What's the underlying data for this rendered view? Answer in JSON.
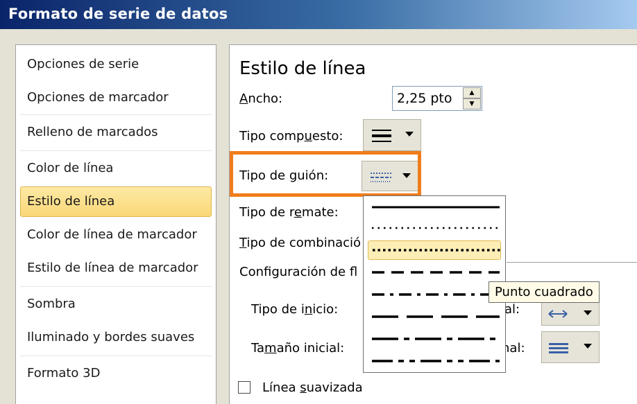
{
  "window": {
    "title": "Formato de serie de datos"
  },
  "sidebar": {
    "items": [
      {
        "label": "Opciones de serie",
        "selected": false
      },
      {
        "label": "Opciones de marcador",
        "selected": false
      },
      {
        "label": "Relleno de marcados",
        "selected": false
      },
      {
        "label": "Color de línea",
        "selected": false
      },
      {
        "label": "Estilo de línea",
        "selected": true
      },
      {
        "label": "Color de línea de marcador",
        "selected": false
      },
      {
        "label": "Estilo de línea de marcador",
        "selected": false
      },
      {
        "label": "Sombra",
        "selected": false
      },
      {
        "label": "Iluminado y bordes suaves",
        "selected": false
      },
      {
        "label": "Formato 3D",
        "selected": false
      }
    ]
  },
  "panel": {
    "heading": "Estilo de línea",
    "width": {
      "label_pre": "",
      "label_ul": "A",
      "label_post": "ncho:",
      "value": "2,25 pto"
    },
    "compound": {
      "label_pre": "Tipo comp",
      "label_ul": "u",
      "label_post": "esto:"
    },
    "dash": {
      "label_pre": "Tipo de ",
      "label_ul": "g",
      "label_post": "uión:"
    },
    "cap": {
      "label_pre": "Tipo de r",
      "label_ul": "e",
      "label_post": "mate:"
    },
    "join": {
      "label_pre": "",
      "label_ul": "T",
      "label_post": "ipo de combinació"
    },
    "arrow_settings": {
      "label": "Configuración de fl"
    },
    "begin_type": {
      "label_pre": "Tipo de i",
      "label_ul": "n",
      "label_post": "icio:"
    },
    "begin_size": {
      "label_pre": "Ta",
      "label_ul": "m",
      "label_post": "año inicial:"
    },
    "end_type_partial": "al:",
    "end_size_partial": "nal:",
    "smooth": {
      "label_pre": "Línea ",
      "label_ul": "s",
      "label_post": "uavizada",
      "checked": false
    }
  },
  "dash_dropdown": {
    "options": [
      "solid",
      "round-dot",
      "square-dot",
      "dash",
      "dash-dot",
      "long-dash",
      "long-dash-dot",
      "long-dash-dot-dot"
    ],
    "highlighted": "square-dot"
  },
  "tooltip": {
    "text": "Punto cuadrado"
  },
  "colors": {
    "highlight_orange": "#f07d1c",
    "selected_item": "#fbd878",
    "title_bar": "#0a246a"
  }
}
